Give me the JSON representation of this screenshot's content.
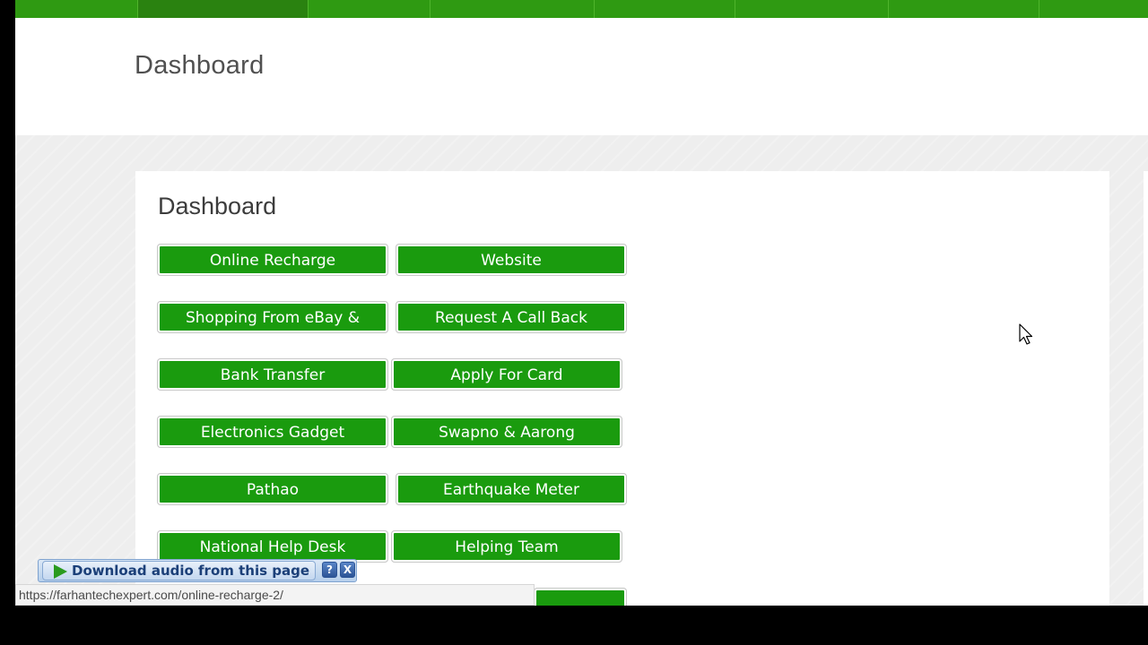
{
  "header": {
    "page_title": "Dashboard"
  },
  "card": {
    "title": "Dashboard",
    "buttons": [
      {
        "label": "Online Recharge"
      },
      {
        "label": "Website"
      },
      {
        "label": "Shopping From eBay &"
      },
      {
        "label": "Request A Call Back"
      },
      {
        "label": "Bank Transfer"
      },
      {
        "label": "Apply For Card"
      },
      {
        "label": "Electronics Gadget"
      },
      {
        "label": "Swapno & Aarong"
      },
      {
        "label": "Pathao"
      },
      {
        "label": "Earthquake Meter"
      },
      {
        "label": "National Help Desk"
      },
      {
        "label": "Helping Team"
      }
    ]
  },
  "download_bar": {
    "label": "Download audio from this page",
    "help": "?",
    "close": "X"
  },
  "status_bar": {
    "url": "https://farhantechexpert.com/online-recharge-2/"
  },
  "colors": {
    "nav_green": "#2f9a12",
    "button_green": "#1a9b0e"
  }
}
